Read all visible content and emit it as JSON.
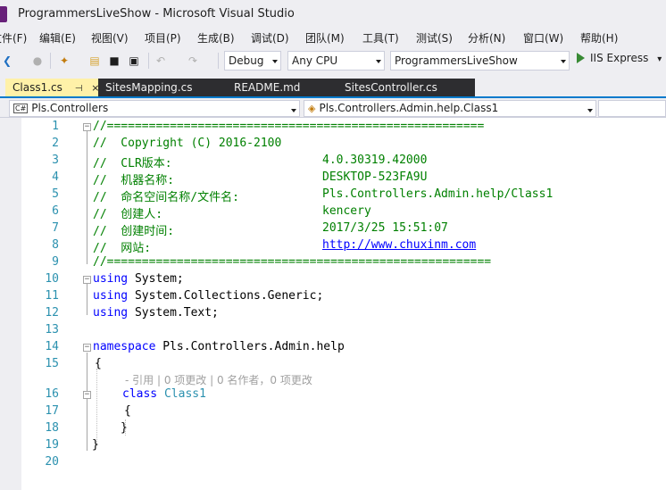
{
  "window": {
    "title": "ProgrammersLiveShow - Microsoft Visual Studio"
  },
  "menu": [
    "文件(F)",
    "编辑(E)",
    "视图(V)",
    "项目(P)",
    "生成(B)",
    "调试(D)",
    "团队(M)",
    "工具(T)",
    "测试(S)",
    "分析(N)",
    "窗口(W)",
    "帮助(H)"
  ],
  "toolbar": {
    "back_icon": "❮",
    "forward_icon": "●",
    "new_icon": "✦",
    "open_icon": "▤",
    "save_icon": "■",
    "saveall_icon": "▣",
    "undo_icon": "↶",
    "redo_icon": "↷",
    "config": "Debug",
    "platform": "Any CPU",
    "startup_project": "ProgrammersLiveShow",
    "run_label": "IIS Express",
    "run_dropdown": "▾"
  },
  "tabs": [
    {
      "label": "Class1.cs",
      "pin": "⊣",
      "close": "×"
    },
    {
      "label": "SitesMapping.cs"
    },
    {
      "label": "README.md"
    },
    {
      "label": "SitesController.cs"
    }
  ],
  "navbar": {
    "project_badge": "C#",
    "project": "Pls.Controllers",
    "type_icon": "◈",
    "type": "Pls.Controllers.Admin.help.Class1"
  },
  "editor": {
    "line_numbers": [
      "1",
      "2",
      "3",
      "4",
      "5",
      "6",
      "7",
      "8",
      "9",
      "10",
      "11",
      "12",
      "13",
      "14",
      "15",
      "16",
      "17",
      "18",
      "19",
      "20"
    ],
    "header_rule_top": "//======================================================",
    "copyright": "//  Copyright (C) 2016-2100",
    "clr_label": "//  CLR版本:                        ",
    "clr_value": "4.0.30319.42000",
    "machine_label": "//  机器名称:                       ",
    "machine_value": "DESKTOP-523FA9U",
    "ns_label": "//  命名空间名称/文件名:            ",
    "ns_value": "Pls.Controllers.Admin.help/Class1",
    "author_label": "//  创建人:                         ",
    "author_value": "kencery",
    "created_label": "//  创建时间:                       ",
    "created_value": "2017/3/25 15:51:07",
    "site_label": "//  网站:                           ",
    "site_value": "http://www.chuxinm.com",
    "header_rule_bottom": "//=======================================================",
    "using1_kw": "using",
    "using1_ns": " System;",
    "using2_kw": "using",
    "using2_ns": " System.Collections.Generic;",
    "using3_kw": "using",
    "using3_ns": " System.Text;",
    "namespace_kw": "namespace",
    "namespace_name": " Pls.Controllers.Admin.help",
    "open_brace": "{",
    "codelens": "- 引用 | 0 项更改 | 0 名作者，0 项更改",
    "class_kw": "class",
    "class_name": "Class1",
    "class_open": "{",
    "class_close": "}",
    "close_brace": "}",
    "fold_minus": "−"
  }
}
